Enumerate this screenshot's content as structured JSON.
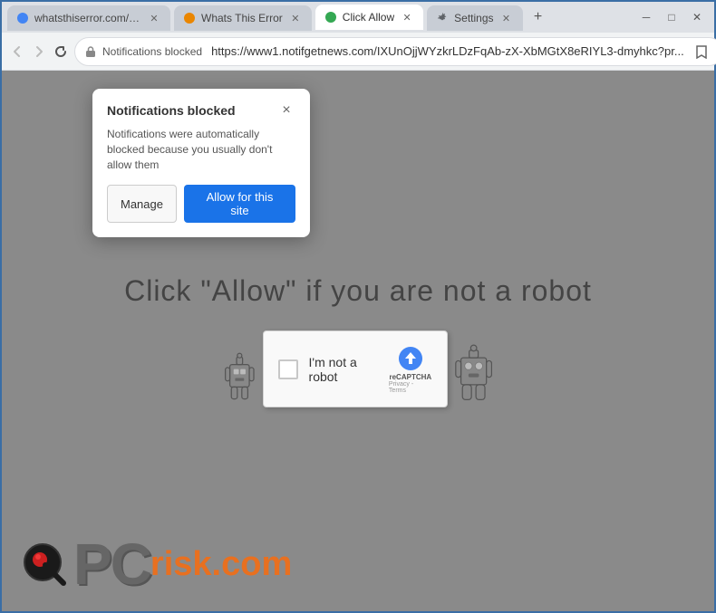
{
  "browser": {
    "tabs": [
      {
        "id": "tab1",
        "label": "whatsthiserror.com/b...",
        "active": false,
        "favicon": "●"
      },
      {
        "id": "tab2",
        "label": "Whats This Error",
        "active": false,
        "favicon": "●"
      },
      {
        "id": "tab3",
        "label": "Click Allow",
        "active": true,
        "favicon": "●"
      },
      {
        "id": "tab4",
        "label": "Settings",
        "active": false,
        "favicon": "⚙"
      }
    ],
    "window_controls": {
      "minimize": "─",
      "maximize": "□",
      "close": "✕"
    },
    "nav": {
      "back": "←",
      "forward": "→",
      "refresh": "↻",
      "security_label": "Notifications blocked",
      "url": "https://www1.notifgetnews.com/IXUnOjjWYzkrLDzFqAb-zX-XbMGtX8eRIYL3-dmyhkc?pr...",
      "bookmark": "☆",
      "profile": "👤",
      "menu": "⋮"
    }
  },
  "notification_popup": {
    "title": "Notifications blocked",
    "close": "×",
    "text": "Notifications were automatically blocked because you usually don't allow them",
    "manage_button": "Manage",
    "allow_button": "Allow for this site"
  },
  "page": {
    "captcha_text": "Click \"Allow\"   if you are not   a robot",
    "captcha_label": "I'm not a robot",
    "recaptcha_brand": "reCAPTCHA",
    "recaptcha_links": "Privacy - Terms"
  },
  "logo": {
    "pc_text": "PC",
    "risk_text": "risk",
    "dot_text": ".",
    "com_text": "com"
  },
  "colors": {
    "accent_blue": "#1a73e8",
    "tab_active_bg": "#ffffff",
    "tab_inactive_bg": "#c8cdd5",
    "nav_bg": "#f1f3f4",
    "page_bg": "#8a8a8a",
    "popup_bg": "#ffffff",
    "orange": "#e87020"
  }
}
